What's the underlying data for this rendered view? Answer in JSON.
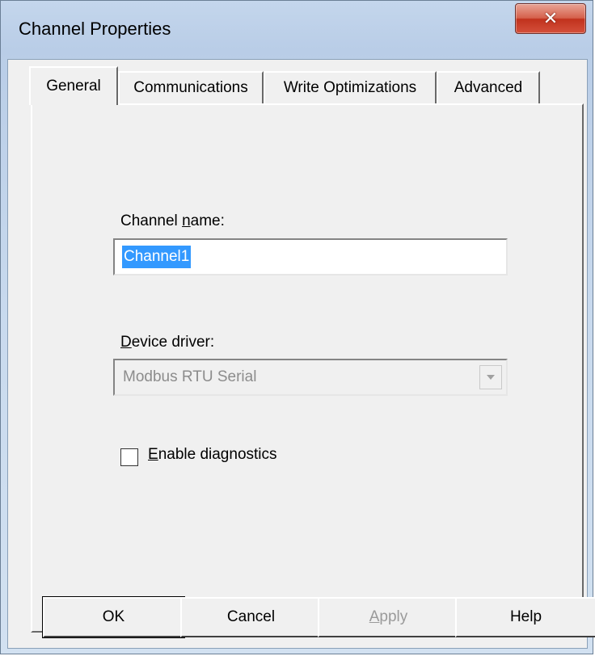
{
  "window": {
    "title": "Channel Properties",
    "close_glyph": "✕"
  },
  "tabs": [
    {
      "label": "General",
      "active": true
    },
    {
      "label": "Communications",
      "active": false
    },
    {
      "label": "Write Optimizations",
      "active": false
    },
    {
      "label": "Advanced",
      "active": false
    }
  ],
  "general": {
    "channel_name_label_prefix": "Channel ",
    "channel_name_label_accel": "n",
    "channel_name_label_suffix": "ame:",
    "channel_name_value": "Channel1",
    "device_driver_label_accel": "D",
    "device_driver_label_suffix": "evice driver:",
    "device_driver_value": "Modbus RTU Serial",
    "dropdown_icon": "chevron-down-icon",
    "enable_diagnostics_accel": "E",
    "enable_diagnostics_suffix": "nable diagnostics",
    "enable_diagnostics_checked": false
  },
  "buttons": {
    "ok": "OK",
    "cancel": "Cancel",
    "apply_accel": "A",
    "apply_suffix": "pply",
    "help": "Help"
  }
}
